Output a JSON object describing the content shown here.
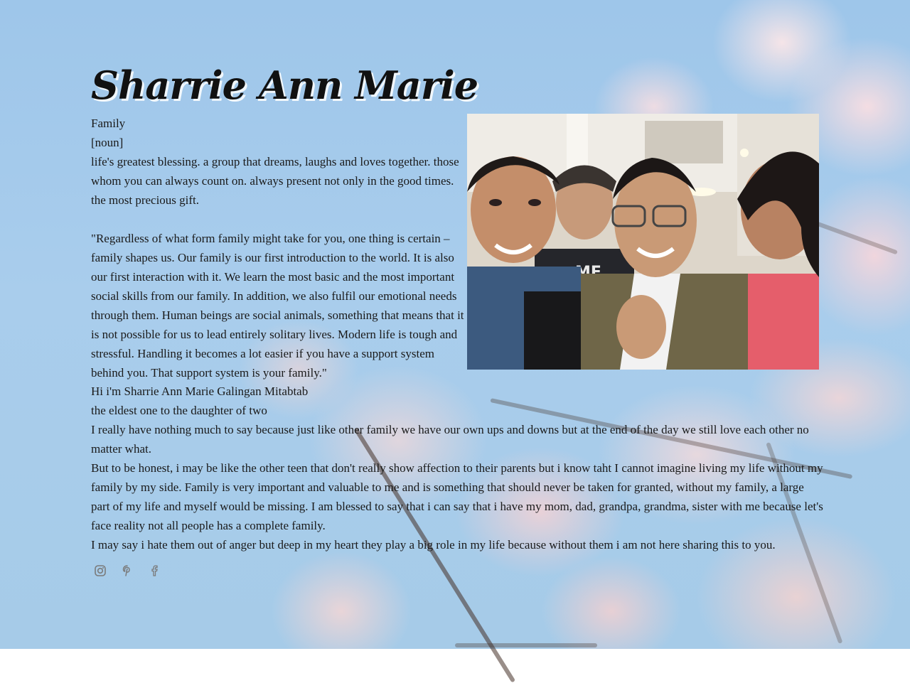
{
  "header": {
    "title": "Sharrie Ann Marie"
  },
  "definition": {
    "word": "Family",
    "part_of_speech": "[noun]",
    "meaning": "life's greatest blessing. a group that dreams, laughs and loves together. those whom you can always count on. always present not only in the good times. the most precious gift."
  },
  "quote": "\"Regardless of what form family might take for you, one thing is certain – family shapes us. Our family is our first introduction to the world. It is also our first interaction with it. We learn the most basic and the most important social skills from our family. In addition, we also fulfil our emotional needs through them. Human beings are social animals, something that means that it is not possible for us to lead entirely solitary lives. Modern life is tough and stressful. Handling it becomes a lot easier if you have a support system behind you. That support system is your family.\"",
  "intro": {
    "line1": "Hi i'm Sharrie Ann Marie Galingan Mitabtab",
    "line2": "the eldest one to the daughter of two"
  },
  "body": {
    "p1": "I really have nothing much to say because just like other family we have our own ups and downs but at the end of the day we still love each other no matter what.",
    "p2": "But to be honest, i may be like the other teen that don't really show affection to their parents but i know taht I cannot imagine living my life without my family by my side. Family is very important and valuable to me and is something that should never be taken for granted, without my family, a large part of my life and myself would be missing. I am blessed to say that i can say that i have my mom, dad, grandpa, grandma, sister with me because let's face reality not all people has a complete family.",
    "p3": "I may say i hate them out of anger but deep in my heart they play a big role in my life because without them i am not here sharing this to you."
  },
  "social": {
    "icons": [
      "instagram-icon",
      "pinterest-icon",
      "facebook-icon"
    ],
    "icon_color": "#7a7a7a"
  },
  "colors": {
    "sky": "#a6cbe8",
    "blossom": "#f2dade",
    "text": "#1a1a1a"
  }
}
